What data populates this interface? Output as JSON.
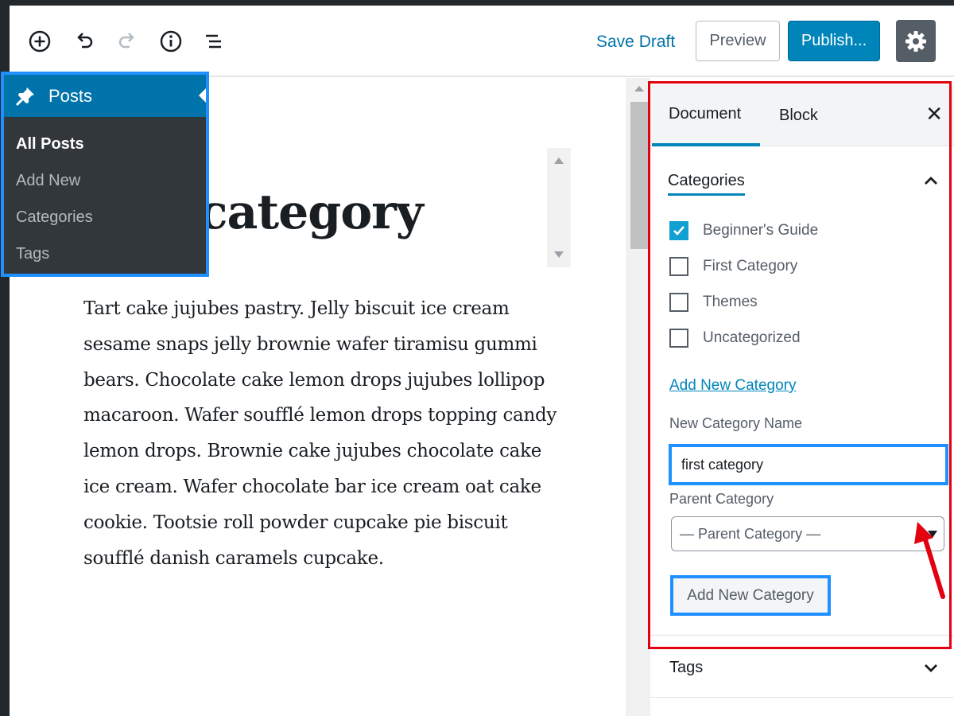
{
  "toolbar": {
    "icons": [
      "add-block-icon",
      "undo-icon",
      "redo-icon",
      "info-icon",
      "outline-icon"
    ],
    "save_draft_label": "Save Draft",
    "preview_label": "Preview",
    "publish_label": "Publish...",
    "settings_icon": "gear-icon"
  },
  "editor": {
    "title_visible": "category",
    "body": "Tart cake jujubes pastry. Jelly biscuit ice cream sesame snaps jelly brownie wafer tiramisu gummi bears. Chocolate cake lemon drops jujubes lollipop macaroon. Wafer soufflé lemon drops topping candy lemon drops. Brownie cake jujubes chocolate cake ice cream. Wafer chocolate bar ice cream oat cake cookie. Tootsie roll powder cupcake pie biscuit soufflé danish caramels cupcake."
  },
  "admin_menu": {
    "heading": "Posts",
    "heading_icon": "pushpin-icon",
    "items": [
      {
        "label": "All Posts",
        "current": true
      },
      {
        "label": "Add New",
        "current": false
      },
      {
        "label": "Categories",
        "current": false
      },
      {
        "label": "Tags",
        "current": false
      }
    ]
  },
  "sidebar": {
    "tabs": [
      {
        "label": "Document",
        "active": true
      },
      {
        "label": "Block",
        "active": false
      }
    ],
    "close_icon": "close-icon",
    "categories": {
      "heading": "Categories",
      "items": [
        {
          "label": "Beginner's Guide",
          "checked": true
        },
        {
          "label": "First Category",
          "checked": false
        },
        {
          "label": "Themes",
          "checked": false
        },
        {
          "label": "Uncategorized",
          "checked": false
        }
      ],
      "add_new_link": "Add New Category",
      "new_name_label": "New Category Name",
      "new_name_value": "first category",
      "parent_label": "Parent Category",
      "parent_selected": "— Parent Category —",
      "add_button": "Add New Category"
    },
    "tags": {
      "heading": "Tags"
    }
  },
  "colors": {
    "accent": "#0085ba",
    "highlight_box": "#1e90ff",
    "annotation_red": "#e3000f",
    "admin_dark": "#32373c"
  }
}
